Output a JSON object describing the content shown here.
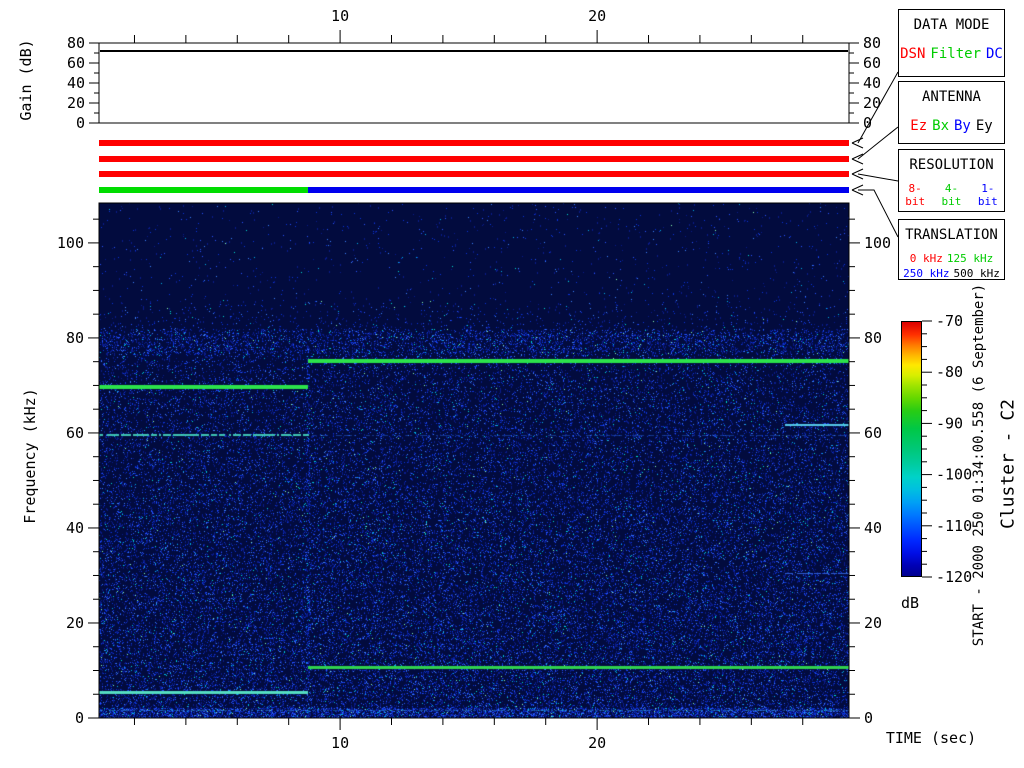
{
  "gain_plot": {
    "ylabel": "Gain (dB)",
    "yticks": [
      80,
      60,
      40,
      20,
      0
    ],
    "minor_step": 10,
    "gain_db": 72
  },
  "time_axis": {
    "label": "TIME (sec)",
    "major_ticks": [
      10,
      20
    ],
    "minor_step": 2,
    "t_min": 0.62,
    "t_max": 29.8
  },
  "freq_axis": {
    "label": "Frequency (kHz)",
    "major_ticks": [
      0,
      20,
      40,
      60,
      80,
      100
    ],
    "minor_step": 5,
    "f_min": 0,
    "f_max": 108.4
  },
  "colorbar": {
    "unit": "dB",
    "ticks": [
      -70,
      -80,
      -90,
      -100,
      -110,
      -120
    ],
    "minor_step": 2.5,
    "value_top": -70,
    "value_bottom": -120
  },
  "annotations": {
    "start": "START - 2000 250 01:34:00.558 (6 September)",
    "spacecraft": "Cluster - C2"
  },
  "panels": [
    {
      "id": "data-mode",
      "title": "DATA MODE",
      "options": [
        {
          "label": "DSN",
          "color": "#ff0000"
        },
        {
          "label": "Filter",
          "color": "#00cc00"
        },
        {
          "label": "DC",
          "color": "#0000ff"
        }
      ]
    },
    {
      "id": "antenna",
      "title": "ANTENNA",
      "options": [
        {
          "label": "Ez",
          "color": "#ff0000"
        },
        {
          "label": "Bx",
          "color": "#00cc00"
        },
        {
          "label": "By",
          "color": "#0000ff"
        },
        {
          "label": "Ey",
          "color": "#000000"
        }
      ]
    },
    {
      "id": "resolution",
      "title": "RESOLUTION",
      "small": true,
      "options": [
        {
          "label": "8-bit",
          "color": "#ff0000"
        },
        {
          "label": "4-bit",
          "color": "#00cc00"
        },
        {
          "label": "1-bit",
          "color": "#0000ff"
        }
      ]
    },
    {
      "id": "translation",
      "title": "TRANSLATION",
      "small": true,
      "two_rows": true,
      "options": [
        {
          "label": "0 kHz",
          "color": "#ff0000"
        },
        {
          "label": "125 kHz",
          "color": "#00cc00"
        },
        {
          "label": "250 kHz",
          "color": "#0000ff"
        },
        {
          "label": "500 kHz",
          "color": "#000000"
        }
      ]
    }
  ],
  "status_bars": [
    {
      "name": "data-mode-bar",
      "segments": [
        {
          "t_start": 0.62,
          "t_end": 29.8,
          "color": "#ff0000",
          "label": "DSN"
        }
      ]
    },
    {
      "name": "antenna-bar",
      "segments": [
        {
          "t_start": 0.62,
          "t_end": 29.8,
          "color": "#ff0000",
          "label": "Ez"
        }
      ]
    },
    {
      "name": "resolution-bar",
      "segments": [
        {
          "t_start": 0.62,
          "t_end": 29.8,
          "color": "#ff0000",
          "label": "8-bit"
        }
      ]
    },
    {
      "name": "translation-bar",
      "segments": [
        {
          "t_start": 0.62,
          "t_end": 8.75,
          "color": "#00dd00",
          "label": "125 kHz"
        },
        {
          "t_start": 8.75,
          "t_end": 29.8,
          "color": "#0000ee",
          "label": "250 kHz"
        }
      ]
    }
  ],
  "chart_data": {
    "type": "heatmap",
    "title": "",
    "x_axis": {
      "label": "TIME (sec)",
      "range": [
        0.62,
        29.8
      ],
      "major_ticks": [
        10,
        20
      ],
      "minor_tick_step": 2
    },
    "y_axis": {
      "label": "Frequency (kHz)",
      "range": [
        0,
        108.4
      ],
      "major_ticks": [
        0,
        20,
        40,
        60,
        80,
        100
      ],
      "minor_tick_step": 5
    },
    "color_axis": {
      "label": "dB",
      "range": [
        -120,
        -70
      ],
      "ticks": [
        -70,
        -80,
        -90,
        -100,
        -110,
        -120
      ]
    },
    "gain_db": 72,
    "segment_boundary_sec": 8.75,
    "background": "#020b3e",
    "noise_floor_cutoff_khz": 82,
    "noise_band": {
      "f_low": 77,
      "f_high": 81
    },
    "emission_lines": [
      {
        "freq_khz": 69.7,
        "t_start": 0.62,
        "t_end": 8.75,
        "color": "#2ce24b",
        "width": 4,
        "style": "solid"
      },
      {
        "freq_khz": 75.2,
        "t_start": 8.75,
        "t_end": 29.8,
        "color": "#2ce24b",
        "width": 4,
        "style": "solid"
      },
      {
        "freq_khz": 59.5,
        "t_start": 0.62,
        "t_end": 8.75,
        "color": "#45d8c0",
        "width": 2,
        "style": "dotted"
      },
      {
        "freq_khz": 59.5,
        "t_start": 8.75,
        "t_end": 29.8,
        "color": "#2566dd",
        "width": 1,
        "style": "faint-dotted"
      },
      {
        "freq_khz": 5.3,
        "t_start": 0.62,
        "t_end": 8.75,
        "color": "#55dcc0",
        "width": 3,
        "style": "solid"
      },
      {
        "freq_khz": 10.7,
        "t_start": 8.75,
        "t_end": 29.8,
        "color": "#30d14e",
        "width": 3,
        "style": "solid"
      },
      {
        "freq_khz": 61.7,
        "t_start": 27.3,
        "t_end": 29.8,
        "color": "#55c8e8",
        "width": 2,
        "style": "solid"
      },
      {
        "freq_khz": 30.5,
        "t_start": 27.3,
        "t_end": 29.8,
        "color": "#3366e0",
        "width": 1,
        "style": "dotted"
      },
      {
        "freq_khz": 1.6,
        "t_start": 0.62,
        "t_end": 29.8,
        "color": "#2d96d2",
        "width": 1,
        "style": "faint-dotted"
      }
    ]
  }
}
